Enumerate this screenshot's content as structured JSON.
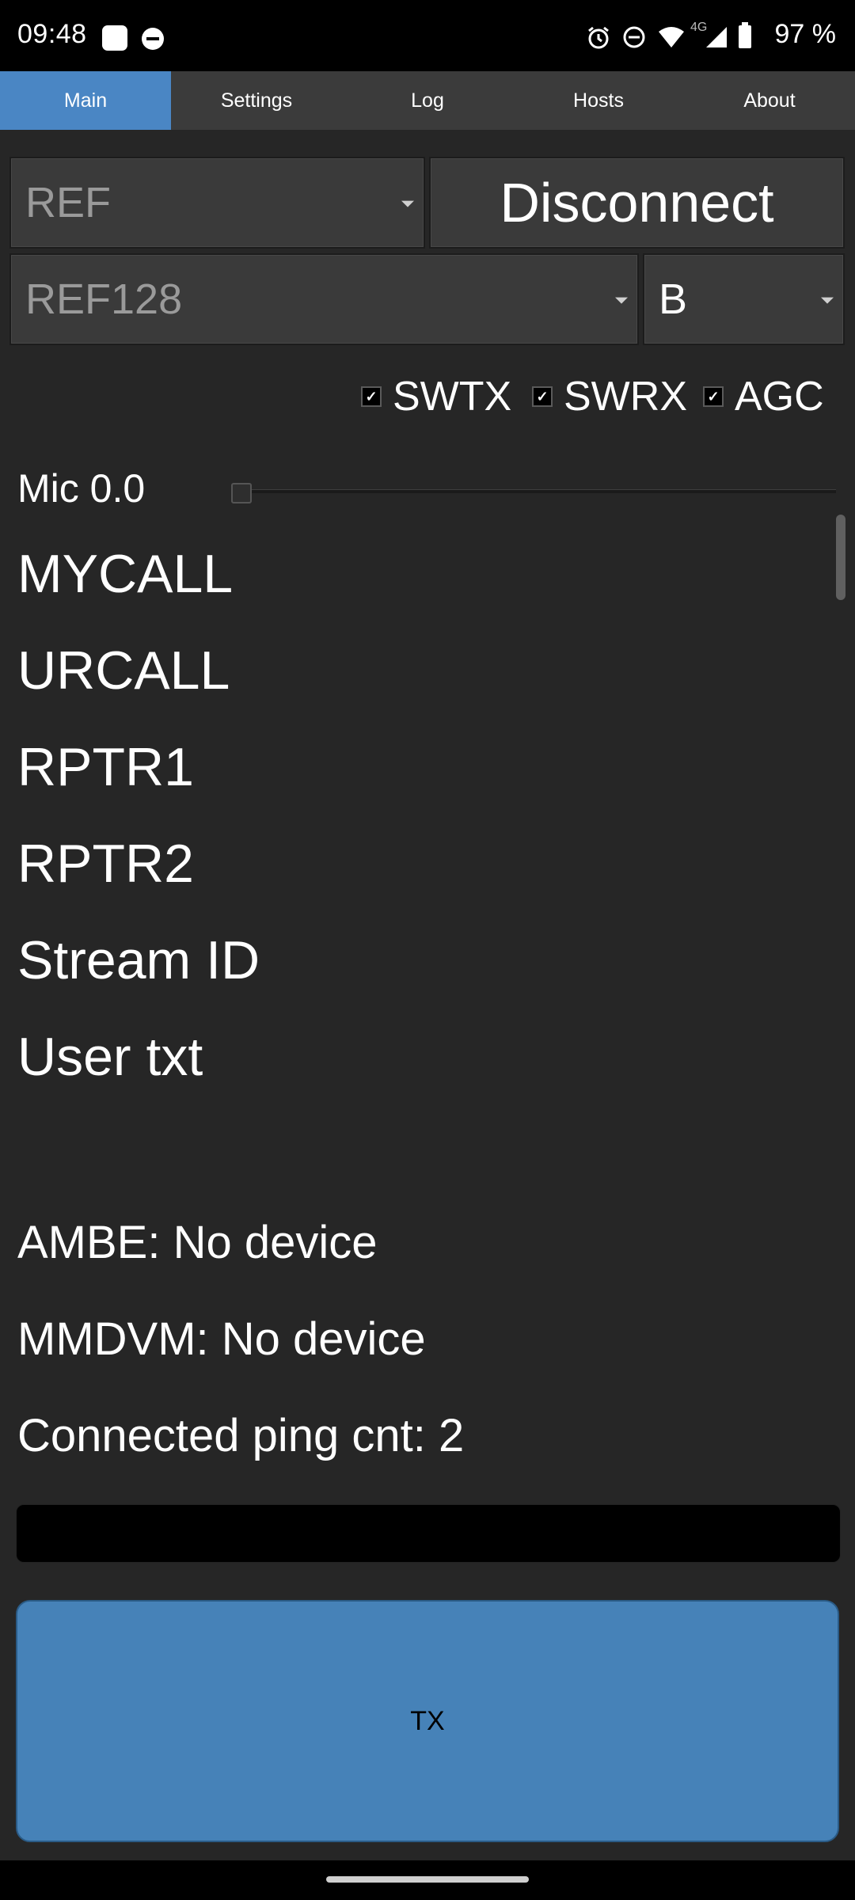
{
  "status_bar": {
    "time": "09:48",
    "network_label": "4G",
    "battery": "97 %",
    "icons": [
      "notification-square-icon",
      "dnd-icon",
      "alarm-icon",
      "dnd-icon",
      "wifi-icon",
      "signal-icon",
      "battery-icon"
    ]
  },
  "tabs": [
    {
      "label": "Main",
      "active": true
    },
    {
      "label": "Settings",
      "active": false
    },
    {
      "label": "Log",
      "active": false
    },
    {
      "label": "Hosts",
      "active": false
    },
    {
      "label": "About",
      "active": false
    }
  ],
  "controls": {
    "mode_select": "REF",
    "connect_button": "Disconnect",
    "host_select": "REF128",
    "module_select": "B"
  },
  "checkboxes": [
    {
      "label": "SWTX",
      "checked": true
    },
    {
      "label": "SWRX",
      "checked": true
    },
    {
      "label": "AGC",
      "checked": true
    }
  ],
  "mic": {
    "label": "Mic 0.0",
    "value": 0.0
  },
  "info_fields": {
    "mycall": "MYCALL",
    "urcall": "URCALL",
    "rptr1": "RPTR1",
    "rptr2": "RPTR2",
    "stream_id": "Stream ID",
    "user_txt": "User txt"
  },
  "status": {
    "ambe": "AMBE: No device",
    "mmdvm": "MMDVM: No device",
    "ping": "Connected ping cnt: 2"
  },
  "text_input": "",
  "tx_button": "TX",
  "colors": {
    "background": "#262626",
    "accent": "#4a86c4",
    "tx_button": "#4682b8",
    "tab_bar": "#3b3b3b"
  }
}
